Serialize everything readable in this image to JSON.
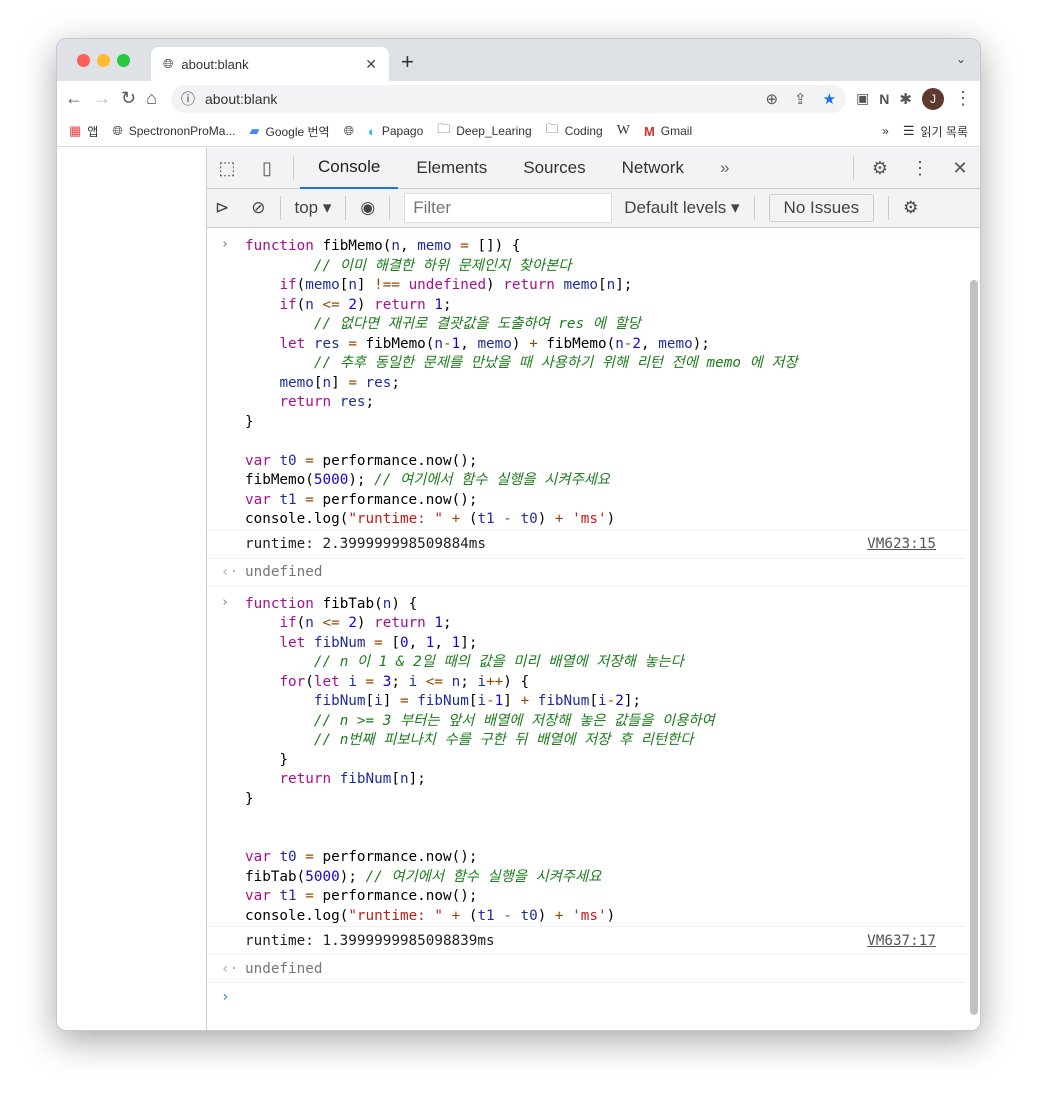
{
  "browser": {
    "tab_title": "about:blank",
    "url": "about:blank",
    "avatar_initial": "J",
    "bookmarks": [
      "앱",
      "SpectrononProMa...",
      "Google 번역",
      "",
      "Papago",
      "Deep_Learing",
      "Coding",
      "W",
      "Gmail"
    ],
    "reading_list": "읽기 목록"
  },
  "devtools": {
    "tabs": [
      "Console",
      "Elements",
      "Sources",
      "Network"
    ],
    "more": "»",
    "context": "top ▾",
    "filter_placeholder": "Filter",
    "levels": "Default levels ▾",
    "issues": "No Issues"
  },
  "console": {
    "block1": [
      "function fibMemo(n, memo = []) {",
      "        // 이미 해결한 하위 문제인지 찾아본다",
      "    if(memo[n] !== undefined) return memo[n];",
      "    if(n <= 2) return 1;",
      "        // 없다면 재귀로 결괏값을 도출하여 res 에 할당",
      "    let res = fibMemo(n-1, memo) + fibMemo(n-2, memo);",
      "        // 추후 동일한 문제를 만났을 때 사용하기 위해 리턴 전에 memo 에 저장",
      "    memo[n] = res;",
      "    return res;",
      "}",
      "",
      "var t0 = performance.now();",
      "fibMemo(5000); // 여기에서 함수 실행을 시켜주세요",
      "var t1 = performance.now();",
      "console.log(\"runtime: \" + (t1 - t0) + 'ms')"
    ],
    "output1": "runtime: 2.399999998509884ms",
    "source1": "VM623:15",
    "undefined_label": "undefined",
    "block2": [
      "function fibTab(n) {",
      "    if(n <= 2) return 1;",
      "    let fibNum = [0, 1, 1];",
      "        // n 이 1 & 2일 때의 값을 미리 배열에 저장해 놓는다",
      "    for(let i = 3; i <= n; i++) {",
      "        fibNum[i] = fibNum[i-1] + fibNum[i-2];",
      "        // n >= 3 부터는 앞서 배열에 저장해 놓은 값들을 이용하여",
      "        // n번째 피보나치 수를 구한 뒤 배열에 저장 후 리턴한다",
      "    }",
      "    return fibNum[n];",
      "}",
      "",
      "",
      "var t0 = performance.now();",
      "fibTab(5000); // 여기에서 함수 실행을 시켜주세요",
      "var t1 = performance.now();",
      "console.log(\"runtime: \" + (t1 - t0) + 'ms')"
    ],
    "output2": "runtime: 1.3999999985098839ms",
    "source2": "VM637:17"
  }
}
